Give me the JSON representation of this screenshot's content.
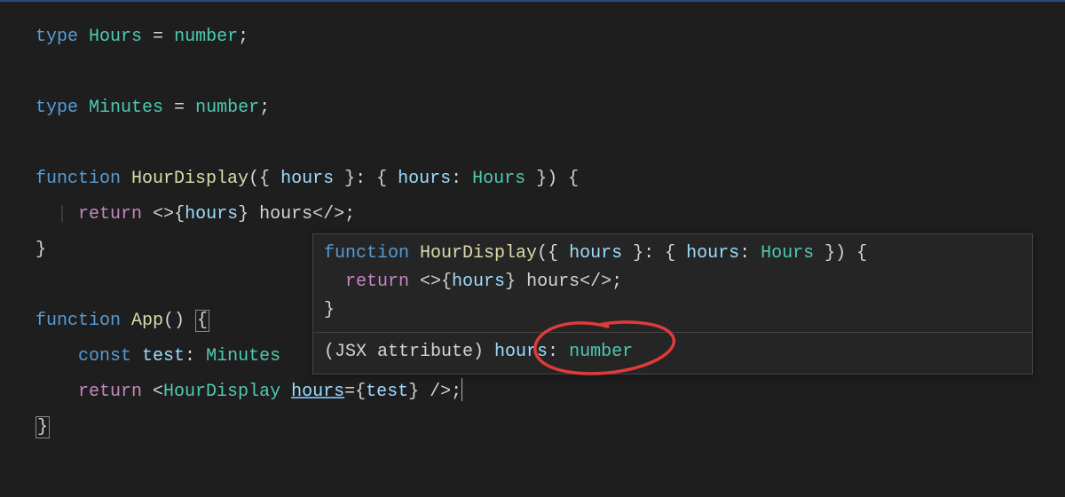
{
  "code": {
    "line1_type": "type",
    "line1_name": "Hours",
    "line1_eq": " = ",
    "line1_value": "number",
    "line1_end": ";",
    "line3_type": "type",
    "line3_name": "Minutes",
    "line3_eq": " = ",
    "line3_value": "number",
    "line3_end": ";",
    "line5_fnkw": "function",
    "line5_fnname": " HourDisplay",
    "line5_open": "({ ",
    "line5_param": "hours",
    "line5_mid": " }: { ",
    "line5_prop": "hours",
    "line5_colon": ": ",
    "line5_ptype": "Hours",
    "line5_close": " }) {",
    "line6_return": "return",
    "line6_jsx1": " <>{",
    "line6_expr": "hours",
    "line6_jsx2": "} hours</>;",
    "line7_close": "}",
    "line9_fnkw": "function",
    "line9_fnname": " App",
    "line9_rest": "() ",
    "line9_brace": "{",
    "line10_const": "const",
    "line10_var": " test",
    "line10_colon": ": ",
    "line10_type": "Minutes",
    "line11_return": "return",
    "line11_open": " <",
    "line11_comp": "HourDisplay",
    "line11_sp": " ",
    "line11_attr": "hours",
    "line11_eq": "={",
    "line11_val": "test",
    "line11_close": "} />;",
    "line12_close": "}"
  },
  "hover": {
    "sig_fnkw": "function",
    "sig_fnname": " HourDisplay",
    "sig_open": "({ ",
    "sig_param": "hours",
    "sig_mid": " }: { ",
    "sig_prop": "hours",
    "sig_colon": ": ",
    "sig_ptype": "Hours",
    "sig_close": " }) {",
    "body_return": "return",
    "body_jsx1": " <>{",
    "body_expr": "hours",
    "body_jsx2": "} hours</>;",
    "body_close": "}",
    "jsxattr_prefix": "(JSX attribute) ",
    "jsxattr_name": "hours",
    "jsxattr_colon": ": ",
    "jsxattr_type": "number"
  }
}
